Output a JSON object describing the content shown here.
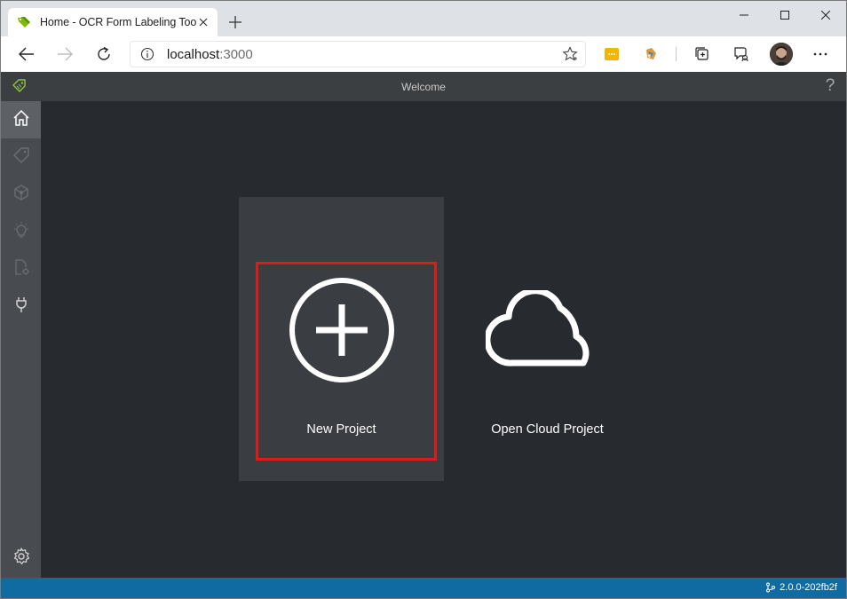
{
  "browser": {
    "tab": {
      "title": "Home - OCR Form Labeling Tool",
      "favicon": "tag-icon"
    },
    "address": {
      "host": "localhost",
      "port": ":3000"
    },
    "colors": {
      "tabstrip": "#dee1e6",
      "toolbar": "#ffffff"
    }
  },
  "app": {
    "title": "Welcome",
    "help": "?",
    "sidebar": [
      {
        "name": "home-icon",
        "active": true
      },
      {
        "name": "tag-icon",
        "active": false
      },
      {
        "name": "model-icon",
        "active": false
      },
      {
        "name": "lightbulb-icon",
        "active": false
      },
      {
        "name": "document-settings-icon",
        "active": false
      },
      {
        "name": "plug-icon",
        "active": false
      },
      {
        "name": "gear-icon",
        "active": false
      }
    ],
    "cards": {
      "new_project": "New Project",
      "open_cloud_project": "Open Cloud Project"
    },
    "version": "2.0.0-202fb2f",
    "colors": {
      "background": "#272b30",
      "sidebar": "#484b4f",
      "statusbar": "#106ba3",
      "highlight": "#e01919",
      "accent": "#8dc63f"
    }
  }
}
